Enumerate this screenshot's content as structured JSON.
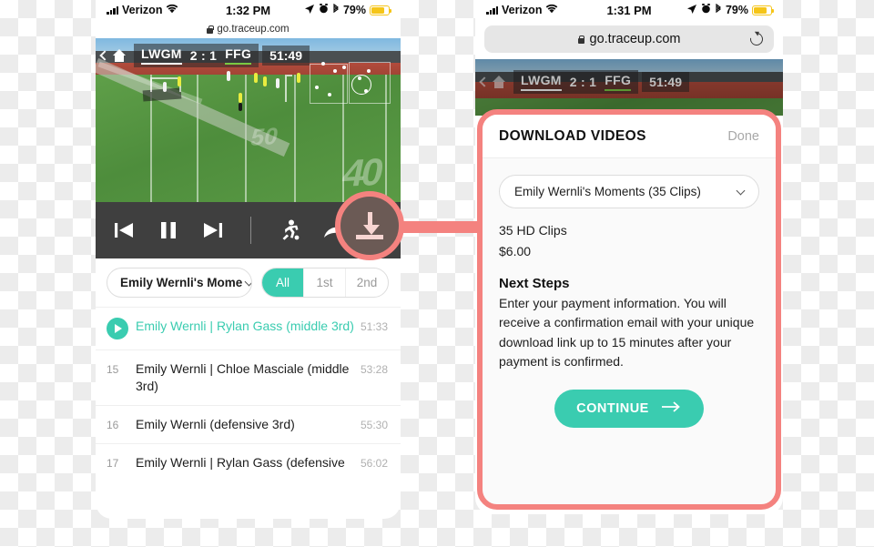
{
  "left_phone": {
    "statusbar": {
      "carrier": "Verizon",
      "time": "1:32 PM",
      "battery": "79%"
    },
    "url": "go.traceup.com",
    "video": {
      "back_icon": "chevron-left-icon",
      "home_icon": "home-icon",
      "team_home": "LWGM",
      "score": "2 : 1",
      "team_away": "FFG",
      "clock": "51:49"
    },
    "controls": {
      "previous": "previous-icon",
      "pause": "pause-icon",
      "next": "next-icon",
      "player_tracking": "running-player-icon",
      "share": "share-arrow-icon",
      "download": "download-icon"
    },
    "filters": {
      "dropdown_label": "Emily Wernli's Mome",
      "segments": [
        "All",
        "1st",
        "2nd"
      ],
      "selected_segment": "All"
    },
    "clips": [
      {
        "index": "",
        "text": "Emily Wernli  |  Rylan Gass (middle 3rd)",
        "time": "51:33",
        "active": true
      },
      {
        "index": "15",
        "text": "Emily Wernli  |  Chloe Masciale (middle 3rd)",
        "time": "53:28",
        "active": false
      },
      {
        "index": "16",
        "text": "Emily Wernli (defensive 3rd)",
        "time": "55:30",
        "active": false
      },
      {
        "index": "17",
        "text": "Emily Wernli  |  Rylan Gass (defensive",
        "time": "56:02",
        "active": false
      }
    ]
  },
  "right_phone": {
    "statusbar": {
      "carrier": "Verizon",
      "time": "1:31 PM",
      "battery": "79%"
    },
    "url": "go.traceup.com",
    "reload_icon": "reload-icon",
    "video": {
      "team_home": "LWGM",
      "score": "2 : 1",
      "team_away": "FFG",
      "clock": "51:49"
    }
  },
  "modal": {
    "title": "DOWNLOAD VIDEOS",
    "done_label": "Done",
    "selection": "Emily Wernli's Moments (35 Clips)",
    "clip_count_label": "35 HD Clips",
    "price": "$6.00",
    "next_steps_heading": "Next Steps",
    "next_steps_body": "Enter your payment information. You will receive a confirmation email with your unique download link up to 15 minutes after your payment is confirmed.",
    "continue_label": "CONTINUE",
    "continue_icon": "arrow-right-icon"
  },
  "annotation": {
    "highlight_color": "#F4827F",
    "accent_color": "#3ACCB0",
    "target_icon": "download-icon"
  }
}
